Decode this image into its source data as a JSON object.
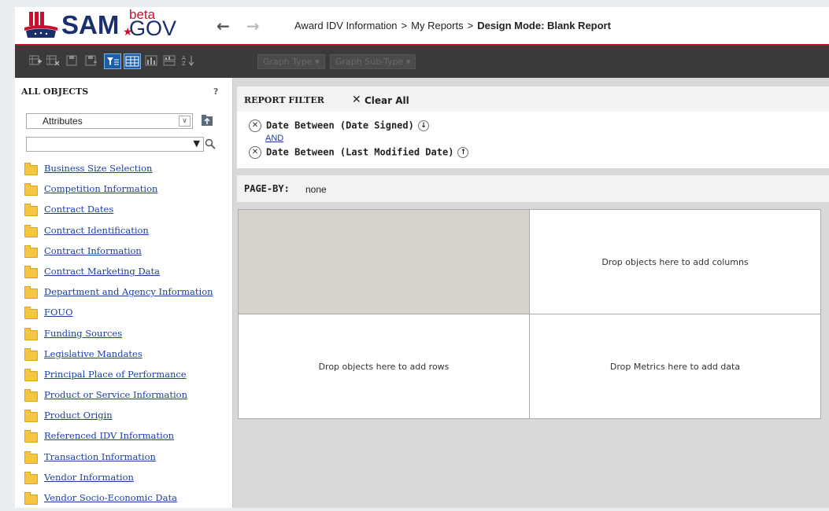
{
  "header": {
    "logo": {
      "sam": "SAM",
      "gov": "GOV",
      "beta": "beta",
      "star": "★"
    },
    "back_icon": "arrow-left-icon",
    "forward_icon": "arrow-right-icon",
    "breadcrumb": {
      "items": [
        "Award IDV Information",
        "My Reports"
      ],
      "separator": ">",
      "current": "Design Mode: Blank Report"
    }
  },
  "toolbar": {
    "icons": [
      "add-data-icon",
      "remove-data-icon",
      "save-icon",
      "save-as-icon",
      "filter-icon",
      "grid-view-icon",
      "graph-view-icon",
      "grid-graph-icon",
      "sort-icon"
    ],
    "graph_type": "Graph Type",
    "graph_subtype": "Graph Sub-Type"
  },
  "left_panel": {
    "title": "ALL OBJECTS",
    "help": "?",
    "object_type": "Attributes",
    "search_value": "",
    "folders": [
      "Business Size Selection",
      "Competition Information",
      "Contract Dates",
      "Contract Identification",
      "Contract Information",
      "Contract Marketing Data",
      "Department and Agency Information",
      "FOUO",
      "Funding Sources",
      "Legislative Mandates",
      "Principal Place of Performance",
      "Product or Service Information",
      "Product Origin",
      "Referenced IDV Information",
      "Transaction Information",
      "Vendor Information",
      "Vendor Socio-Economic Data"
    ]
  },
  "report_filter": {
    "title": "REPORT FILTER",
    "clear_all": "Clear All",
    "conditions": [
      "Date Between (Date Signed)",
      "Date Between (Last Modified Date)"
    ],
    "operator": "AND"
  },
  "page_by": {
    "label": "PAGE-BY:",
    "value": "none"
  },
  "grid": {
    "columns_hint": "Drop objects here to add columns",
    "rows_hint": "Drop objects here to add rows",
    "metrics_hint": "Drop Metrics here to add data"
  },
  "colors": {
    "brand_navy": "#1a2f6b",
    "brand_red": "#c8102e",
    "toolbar_bg": "#3a3a3a",
    "link_blue": "#1a3fa0",
    "folder_yellow": "#f5c644"
  }
}
